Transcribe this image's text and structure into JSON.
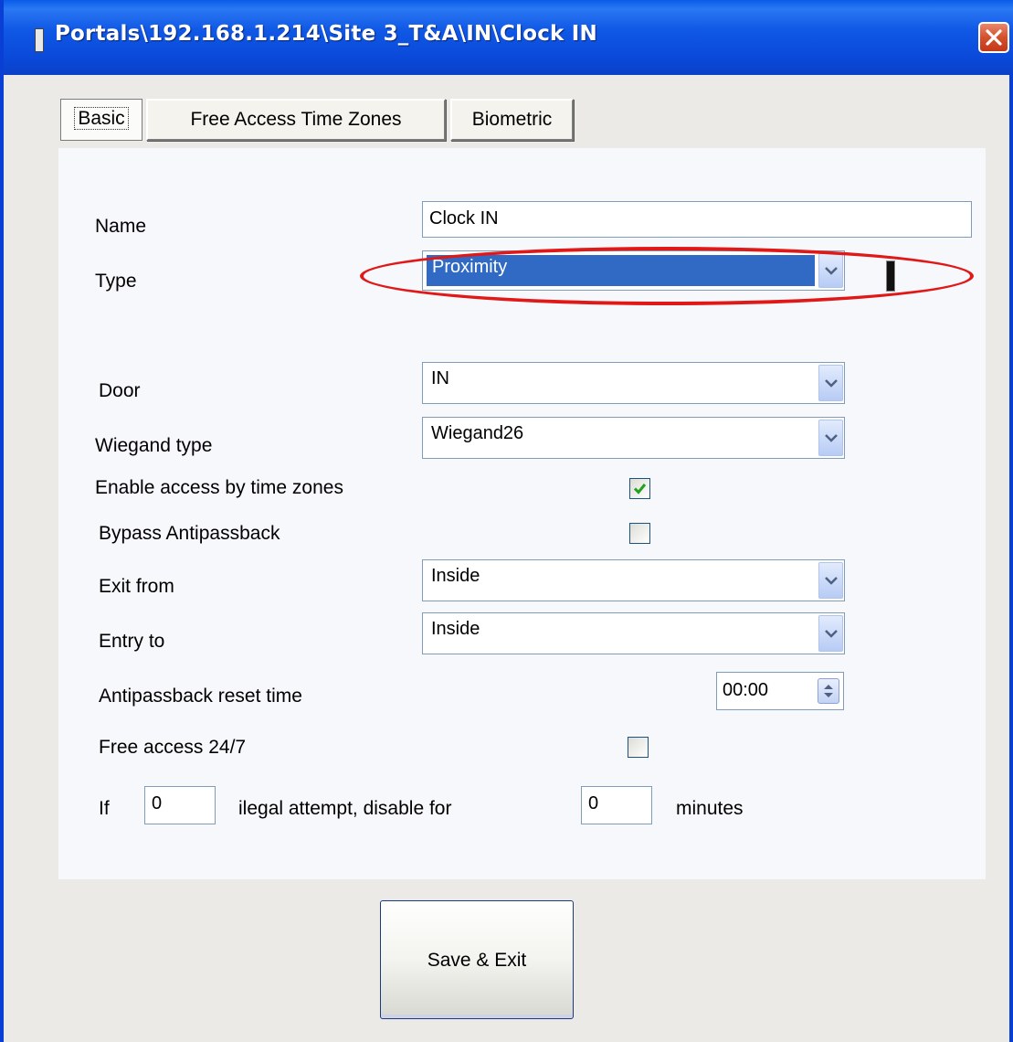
{
  "window": {
    "title": "Portals\\192.168.1.214\\Site 3_T&A\\IN\\Clock IN"
  },
  "tabs": [
    {
      "label": "Basic",
      "active": true
    },
    {
      "label": "Free Access Time Zones",
      "active": false
    },
    {
      "label": "Biometric",
      "active": false
    }
  ],
  "form": {
    "name_label": "Name",
    "name_value": "Clock IN",
    "type_label": "Type",
    "type_value": "Proximity",
    "door_label": "Door",
    "door_value": "IN",
    "wiegand_label": "Wiegand type",
    "wiegand_value": "Wiegand26",
    "time_zones_label": "Enable access by time zones",
    "time_zones_checked": true,
    "bypass_label": "Bypass Antipassback",
    "bypass_checked": false,
    "exit_from_label": "Exit from",
    "exit_from_value": "Inside",
    "entry_to_label": "Entry to",
    "entry_to_value": "Inside",
    "reset_time_label": "Antipassback reset time",
    "reset_time_value": "00:00",
    "free_access_label": "Free access 24/7",
    "free_access_checked": false,
    "if_label": "If",
    "attempts_value": "0",
    "attempt_text": "ilegal attempt, disable for",
    "minutes_value": "0",
    "minutes_label": "minutes"
  },
  "buttons": {
    "save_exit": "Save & Exit"
  },
  "colors": {
    "titlebar": "#0a48d8",
    "selection": "#316ac5",
    "highlight_ellipse": "#e01818"
  },
  "icons": {
    "title": "window-icon",
    "close": "close-icon",
    "dropdown": "chevron-down-icon",
    "check": "check-icon",
    "spinner": "spinner-arrows-icon"
  }
}
